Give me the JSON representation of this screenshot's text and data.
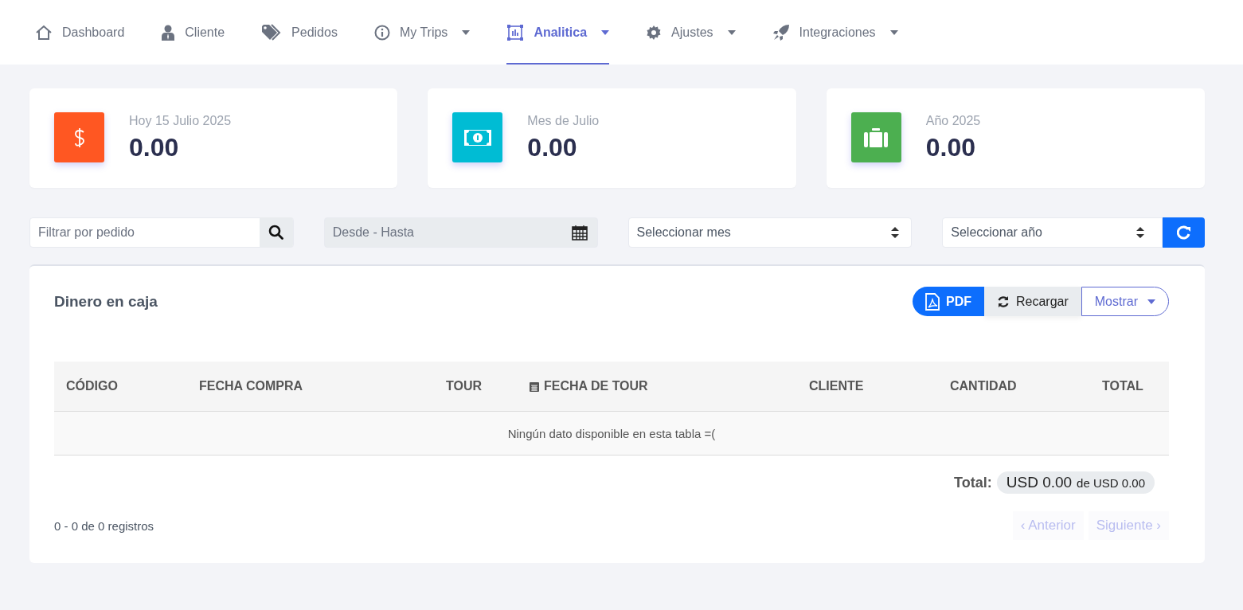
{
  "nav": {
    "items": [
      {
        "label": "Dashboard",
        "selected": false,
        "dropdown": false
      },
      {
        "label": "Cliente",
        "selected": false,
        "dropdown": false
      },
      {
        "label": "Pedidos",
        "selected": false,
        "dropdown": false
      },
      {
        "label": "My Trips",
        "selected": false,
        "dropdown": true
      },
      {
        "label": "Analitica",
        "selected": true,
        "dropdown": true
      },
      {
        "label": "Ajustes",
        "selected": false,
        "dropdown": true
      },
      {
        "label": "Integraciones",
        "selected": false,
        "dropdown": true
      }
    ]
  },
  "stats": [
    {
      "label": "Hoy 15 Julio 2025",
      "value": "0.00",
      "color": "#ff5722"
    },
    {
      "label": "Mes de Julio",
      "value": "0.00",
      "color": "#00bcd4"
    },
    {
      "label": "Año 2025",
      "value": "0.00",
      "color": "#4caf50"
    }
  ],
  "filters": {
    "order_search": {
      "placeholder": "Filtrar por pedido"
    },
    "date_range": {
      "placeholder": "Desde - Hasta"
    },
    "month_select": {
      "value": "Seleccionar mes"
    },
    "year_select": {
      "value": "Seleccionar año"
    }
  },
  "panel": {
    "title": "Dinero en caja",
    "buttons": [
      {
        "label": "PDF",
        "kind": "pdf"
      },
      {
        "label": "Recargar",
        "kind": "reload"
      },
      {
        "label": "Mostrar",
        "kind": "menu"
      }
    ],
    "table": {
      "columns": [
        {
          "label": "CÓDIGO",
          "kind": "text"
        },
        {
          "label": "FECHA COMPRA",
          "kind": "text"
        },
        {
          "label": "TOUR",
          "kind": "text"
        },
        {
          "label": "FECHA DE TOUR",
          "kind": "date"
        },
        {
          "label": "CLIENTE",
          "kind": "text"
        },
        {
          "label": "CANTIDAD",
          "kind": "text"
        },
        {
          "label": "TOTAL",
          "kind": "text"
        }
      ],
      "empty_message": "Ningún dato disponible en esta tabla =("
    },
    "total": {
      "label": "Total:",
      "amount": "USD 0.00",
      "of": "de USD 0.00"
    },
    "records": "0 - 0 de 0 registros",
    "pagination": [
      {
        "label": "‹ Anterior",
        "disabled": true
      },
      {
        "label": "Siguiente ›",
        "disabled": true
      }
    ]
  }
}
